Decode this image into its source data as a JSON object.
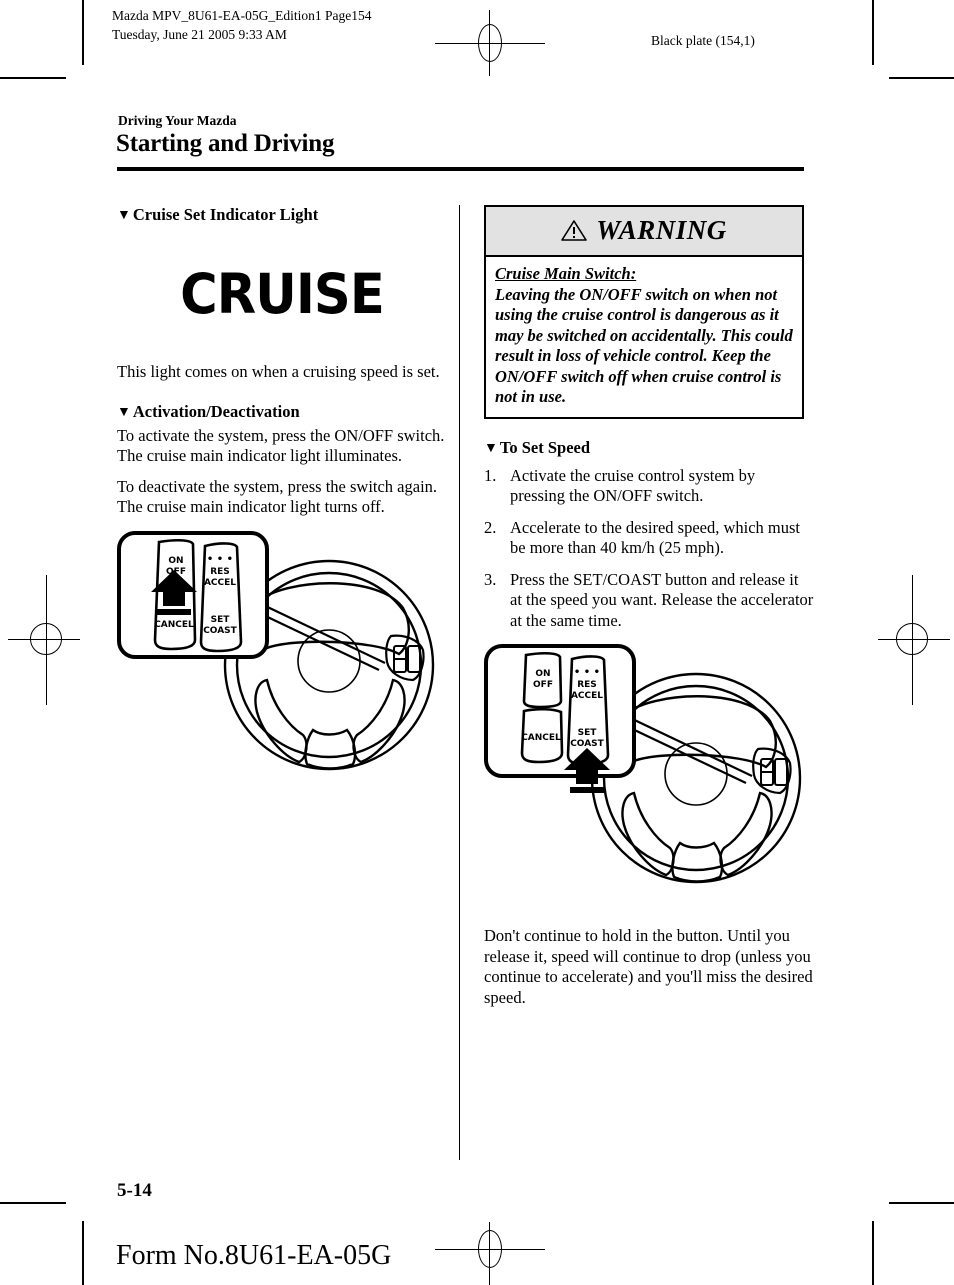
{
  "page_header": {
    "line1": "Mazda MPV_8U61-EA-05G_Edition1 Page154",
    "line2": "Tuesday, June 21 2005 9:33 AM",
    "black_plate": "Black plate (154,1)"
  },
  "section": {
    "kicker": "Driving Your Mazda",
    "title": "Starting and Driving"
  },
  "left_column": {
    "heading_indicator": "Cruise Set Indicator Light",
    "indicator_graphic_text": "CRUISE",
    "indicator_paragraph": "This light comes on when a cruising speed is set.",
    "heading_activation": "Activation/Deactivation",
    "activation_paragraph_1": "To activate the system, press the ON/OFF switch.",
    "activation_paragraph_2": "The cruise main indicator light illuminates.",
    "activation_paragraph_3": "To deactivate the system, press the switch again.",
    "activation_paragraph_4": "The cruise main indicator light turns off."
  },
  "warning": {
    "title": "WARNING",
    "icon": "warning-triangle-icon",
    "label": "Cruise Main Switch:",
    "text": "Leaving the ON/OFF switch on when not using the cruise control is dangerous as it may be switched on accidentally. This could result in loss of vehicle control. Keep the ON/OFF switch off when cruise control is not in use."
  },
  "right_column": {
    "heading_set_speed": "To Set Speed",
    "steps": [
      {
        "num": "1.",
        "text": "Activate the cruise control system by pressing the ON/OFF switch."
      },
      {
        "num": "2.",
        "text": "Accelerate to the desired speed, which must be more than 40 km/h (25 mph)."
      },
      {
        "num": "3.",
        "text": "Press the SET/COAST button and release it at the speed you want. Release the accelerator at the same time."
      }
    ],
    "closing_paragraph": "Don't continue to hold in the button. Until you release it, speed will continue to drop (unless you continue to accelerate) and you'll miss the desired speed."
  },
  "illustration_switches": {
    "on_off_line1": "ON",
    "on_off_line2": "OFF",
    "cancel": "CANCEL",
    "res_line1": "RES",
    "res_line2": "ACCEL",
    "set_line1": "SET",
    "set_line2": "COAST",
    "dots": "• • •"
  },
  "footer": {
    "page_number": "5-14",
    "form_number": "Form No.8U61-EA-05G"
  },
  "triangle_bullet": "▼"
}
